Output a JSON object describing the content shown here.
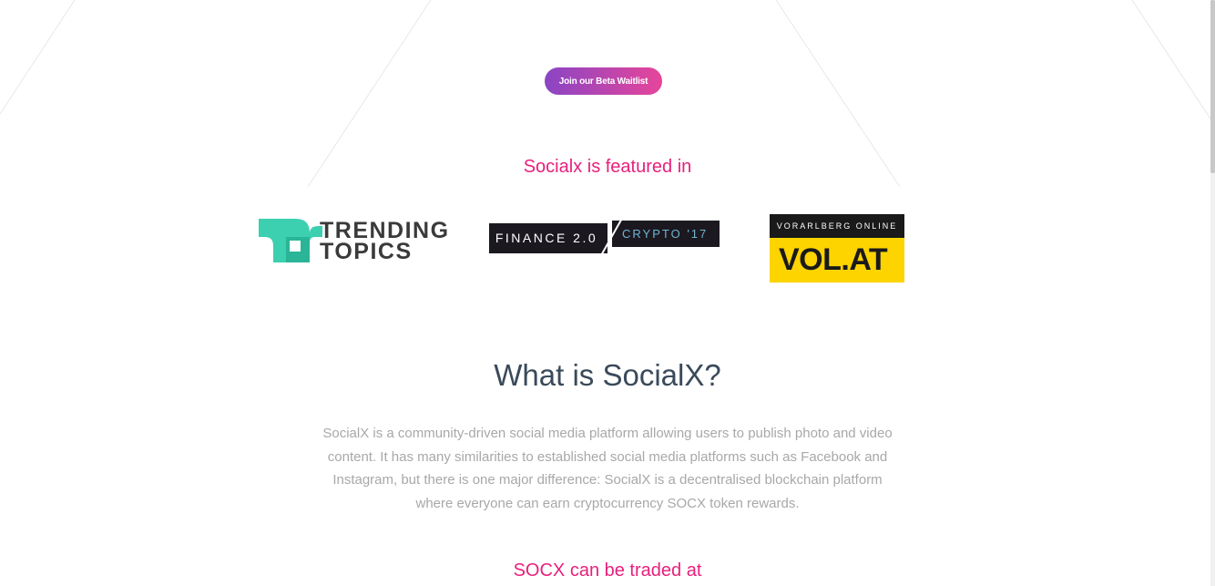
{
  "cta": {
    "beta_label": "Join our Beta Waitlist"
  },
  "featured": {
    "title": "Socialx is featured in",
    "logos": [
      {
        "name": "trending-topics",
        "line1": "TRENDING",
        "line2": "TOPICS",
        "color": "#3ccfb0"
      },
      {
        "name": "finance-crypto",
        "left": "FINANCE 2.0",
        "right": "CRYPTO '17"
      },
      {
        "name": "vol-at",
        "top": "VORARLBERG ONLINE",
        "main": "VOL.AT",
        "color": "#fdd300"
      }
    ]
  },
  "about": {
    "title": "What is SocialX?",
    "lines": [
      "SocialX is a community-driven social media platform allowing users to publish photo and video",
      "content. It has many similarities to established social media platforms such as Facebook and",
      "Instagram, but there is one major difference: SocialX is a decentralised blockchain platform",
      "where everyone can earn cryptocurrency SOCX token rewards."
    ]
  },
  "traded": {
    "title": "SOCX can be traded at"
  },
  "colors": {
    "accent": "#e7207c",
    "gradient_start": "#8a45c4",
    "gradient_end": "#e6459a",
    "heading": "#3a4a5a"
  }
}
